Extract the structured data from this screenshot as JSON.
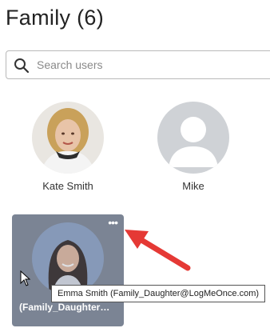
{
  "header": {
    "title": "Family (6)"
  },
  "search": {
    "placeholder": "Search users",
    "value": "",
    "icon": "search-icon"
  },
  "users": [
    {
      "name": "Kate Smith",
      "avatar": "photo"
    },
    {
      "name": "Mike",
      "avatar": "default-avatar"
    }
  ],
  "selected_card": {
    "label": "(Family_Daughter@LogMeOnce.com)",
    "more_label": "•••",
    "tooltip": "Emma Smith (Family_Daughter@LogMeOnce.com)"
  },
  "colors": {
    "card_bg": "#7b8494",
    "annotation_arrow": "#e53935",
    "default_avatar_bg": "#cfd2d6"
  }
}
